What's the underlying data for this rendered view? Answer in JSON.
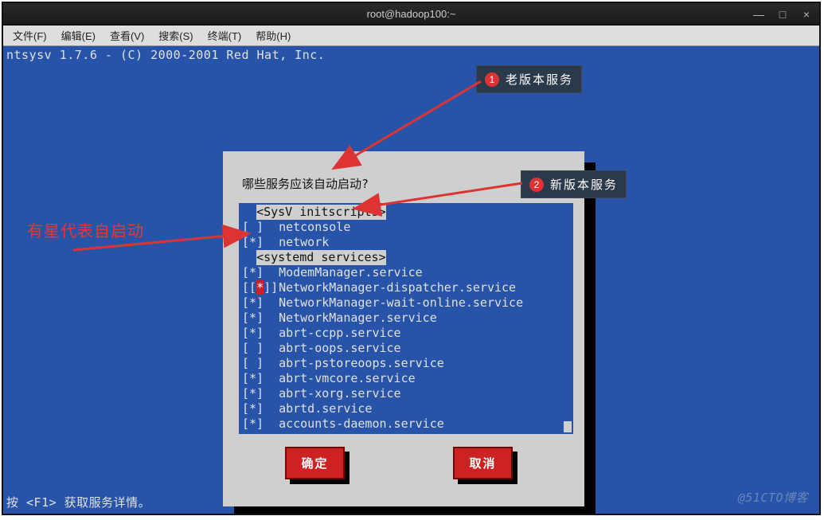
{
  "window": {
    "title": "root@hadoop100:~",
    "buttons": {
      "min": "—",
      "max": "□",
      "close": "×"
    }
  },
  "menubar": {
    "file": "文件(F)",
    "edit": "编辑(E)",
    "view": "查看(V)",
    "search": "搜索(S)",
    "terminal": "终端(T)",
    "help": "帮助(H)"
  },
  "terminal": {
    "header": "ntsysv 1.7.6 - (C) 2000-2001  Red Hat, Inc.",
    "footer": "按  <F1> 获取服务详情。"
  },
  "dialog": {
    "question": "哪些服务应该自动启动?",
    "group_sysv": "<SysV initscripts>",
    "group_systemd": "<systemd services>",
    "services": [
      {
        "mark": "off",
        "name": "netconsole"
      },
      {
        "mark": "on",
        "name": "network"
      },
      {
        "mark": "on",
        "name": "ModemManager.service"
      },
      {
        "mark": "onred",
        "name": "NetworkManager-dispatcher.service"
      },
      {
        "mark": "on",
        "name": "NetworkManager-wait-online.service"
      },
      {
        "mark": "on",
        "name": "NetworkManager.service"
      },
      {
        "mark": "on",
        "name": "abrt-ccpp.service"
      },
      {
        "mark": "off",
        "name": "abrt-oops.service"
      },
      {
        "mark": "off",
        "name": "abrt-pstoreoops.service"
      },
      {
        "mark": "on",
        "name": "abrt-vmcore.service"
      },
      {
        "mark": "on",
        "name": "abrt-xorg.service"
      },
      {
        "mark": "on",
        "name": "abrtd.service"
      },
      {
        "mark": "on",
        "name": "accounts-daemon.service"
      }
    ],
    "ok": "确定",
    "cancel": "取消"
  },
  "annotations": {
    "badge1_num": "1",
    "badge1_text": "老版本服务",
    "badge2_num": "2",
    "badge2_text": "新版本服务",
    "star_note": "有星代表自启动",
    "watermark": "@51CTO博客"
  }
}
